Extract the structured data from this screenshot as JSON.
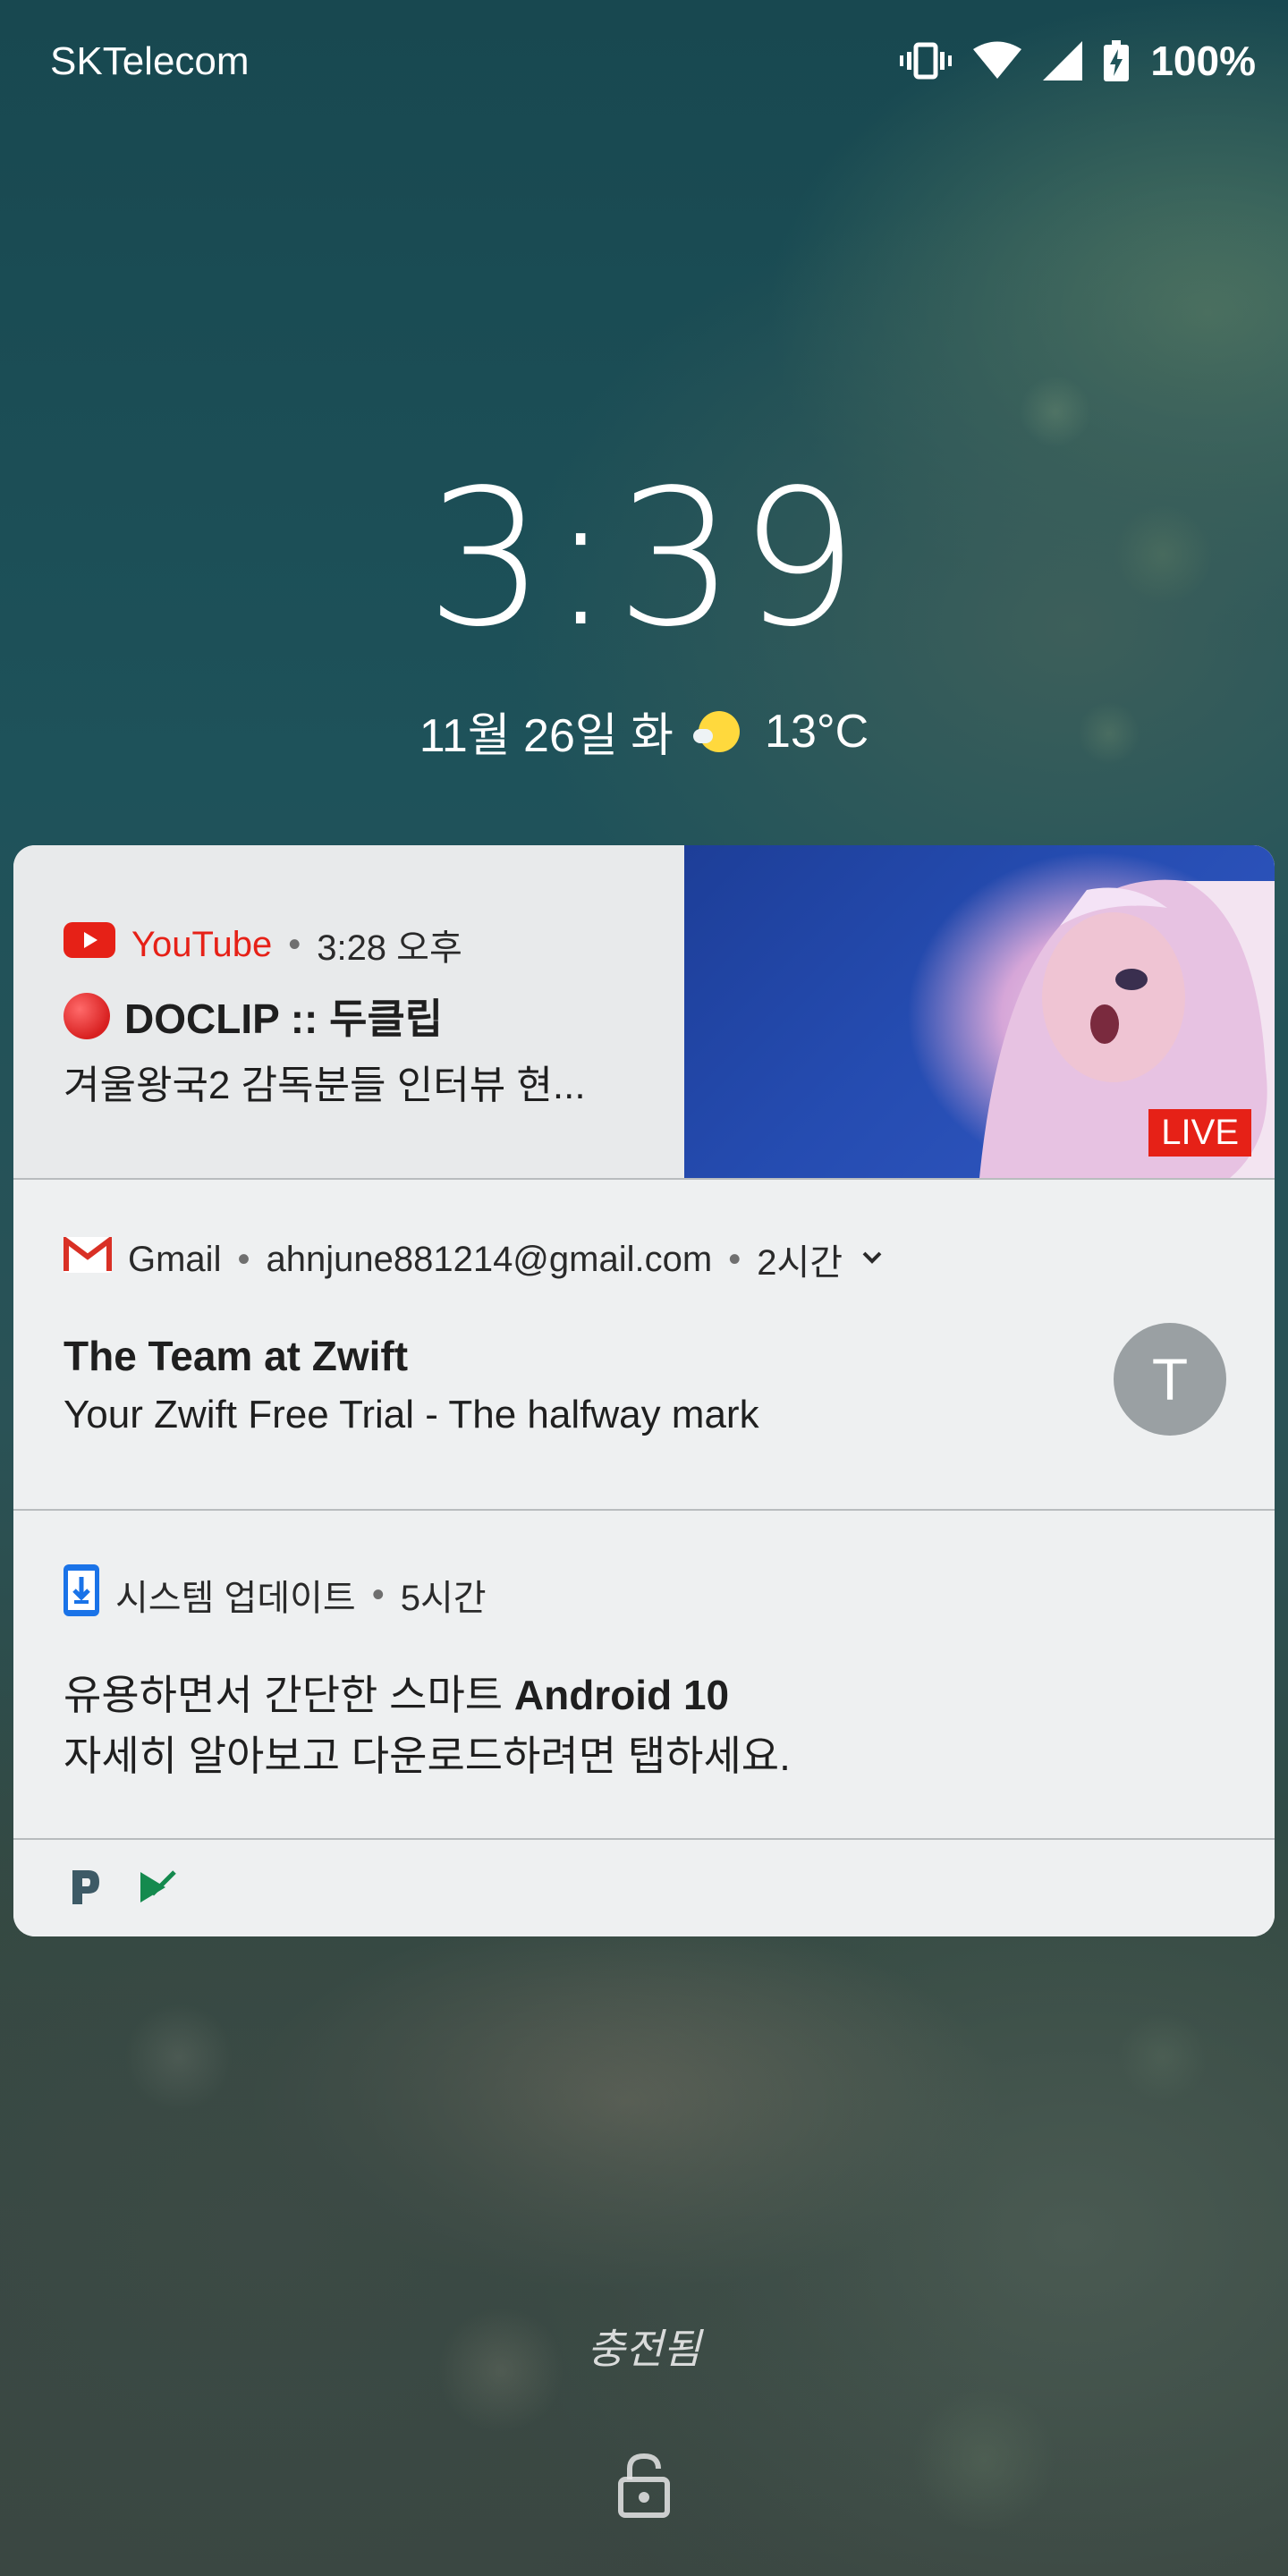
{
  "status_bar": {
    "carrier": "SKTelecom",
    "battery": "100%",
    "icons": [
      "vibrate-icon",
      "wifi-icon",
      "signal-icon",
      "battery-charging-icon"
    ]
  },
  "lockscreen": {
    "time": "3:39",
    "date": "11월 26일 화",
    "weather_icon": "partly-sunny-icon",
    "temperature": "13°C",
    "charging_label": "충전됨",
    "bottom_icon": "lock-icon"
  },
  "notifications": {
    "youtube": {
      "app": "YouTube",
      "time": "3:28 오후",
      "title": "DOCLIP :: 두클립",
      "text": "겨울왕국2 감독분들 인터뷰 현...",
      "badge": "LIVE",
      "accent": "#e62117"
    },
    "gmail": {
      "app": "Gmail",
      "account": "ahnjune881214@gmail.com",
      "time": "2시간",
      "title": "The Team at Zwift",
      "text": "Your Zwift Free Trial - The halfway mark",
      "avatar_letter": "T"
    },
    "system_update": {
      "app": "시스템 업데이트",
      "time": "5시간",
      "line1_prefix": "유용하면서 간단한 스마트",
      "line1_bold": "Android 10",
      "line2": "자세히 알아보고 다운로드하려면 탭하세요."
    },
    "footer": {
      "icons": [
        "pandora-icon",
        "task-check-icon"
      ]
    }
  }
}
